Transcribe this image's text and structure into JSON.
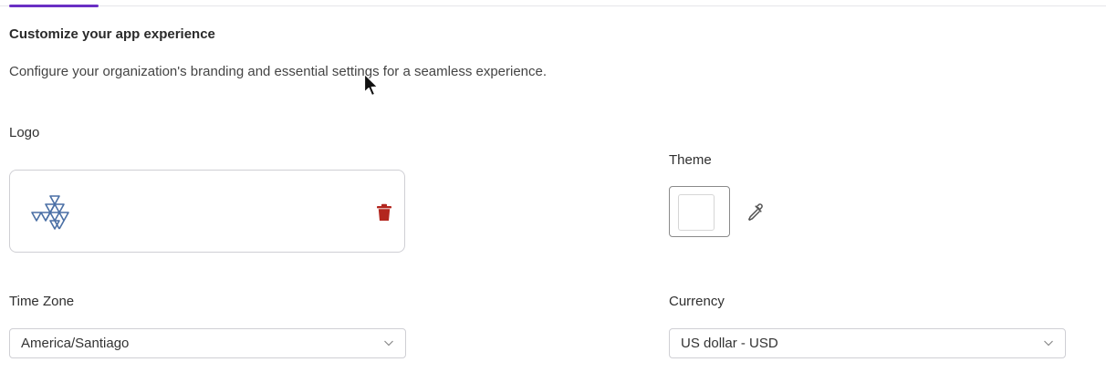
{
  "header": {
    "title": "Customize your app experience",
    "description": "Configure your organization's branding and essential settings for a seamless experience."
  },
  "logo": {
    "label": "Logo",
    "delete_icon": "trash-icon",
    "logo_icon": "triangle-grid-logo"
  },
  "theme": {
    "label": "Theme",
    "swatch_color": "#ffffff",
    "picker_icon": "eyedropper-icon"
  },
  "timezone": {
    "label": "Time Zone",
    "value": "America/Santiago"
  },
  "currency": {
    "label": "Currency",
    "value": "US dollar - USD"
  },
  "colors": {
    "accent": "#6a2fc4",
    "delete": "#b3261e",
    "logo_stroke": "#4a6fa5"
  }
}
